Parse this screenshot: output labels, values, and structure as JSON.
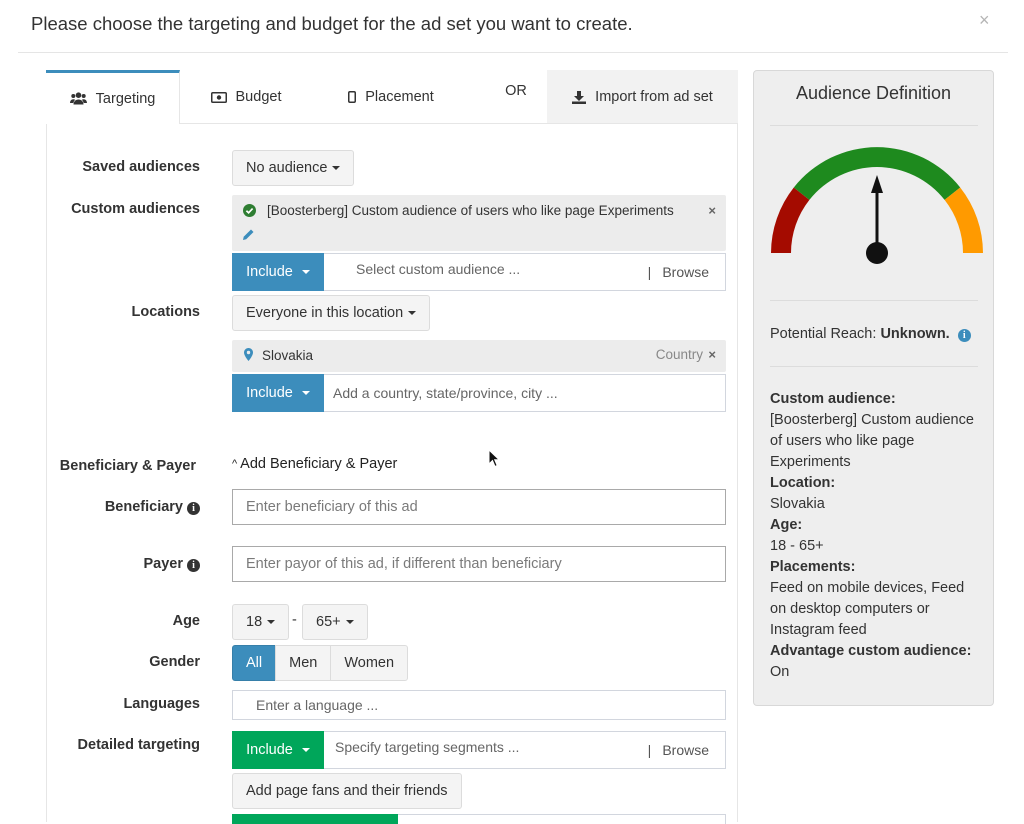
{
  "modal": {
    "title": "Please choose the targeting and budget for the ad set you want to create.",
    "close": "×"
  },
  "tabs": {
    "targeting": "Targeting",
    "budget": "Budget",
    "placement": "Placement",
    "or": "OR",
    "import": "Import from ad set"
  },
  "form": {
    "saved_audiences": {
      "label": "Saved audiences",
      "value": "No audience"
    },
    "custom_audiences": {
      "label": "Custom audiences",
      "chip_text": "[Boosterberg] Custom audience of users who like page Experiments",
      "include_label": "Include",
      "placeholder": "Select custom audience ...",
      "browse": "Browse"
    },
    "locations": {
      "label": "Locations",
      "mode": "Everyone in this location",
      "chip_text": "Slovakia",
      "chip_type": "Country",
      "include_label": "Include",
      "placeholder": "Add a country, state/province, city ..."
    },
    "beneficiary_payer": {
      "label": "Beneficiary & Payer",
      "toggle": "Add Beneficiary & Payer"
    },
    "beneficiary": {
      "label": "Beneficiary",
      "placeholder": "Enter beneficiary of this ad"
    },
    "payer": {
      "label": "Payer",
      "placeholder": "Enter payor of this ad, if different than beneficiary"
    },
    "age": {
      "label": "Age",
      "min": "18",
      "separator": "-",
      "max": "65+"
    },
    "gender": {
      "label": "Gender",
      "options": [
        "All",
        "Men",
        "Women"
      ],
      "selected": "All"
    },
    "languages": {
      "label": "Languages",
      "placeholder": "Enter a language ..."
    },
    "detailed_targeting": {
      "label": "Detailed targeting",
      "include_label": "Include",
      "placeholder": "Specify targeting segments ...",
      "browse": "Browse",
      "add_button": "Add page fans and their friends"
    }
  },
  "audience_panel": {
    "title": "Audience Definition",
    "gauge": {
      "needle_direction": "up",
      "zones": [
        "red",
        "green",
        "orange"
      ]
    },
    "reach_label": "Potential Reach:",
    "reach_value": "Unknown.",
    "summary": [
      {
        "heading": "Custom audience:",
        "value": "[Boosterberg] Custom audience of users who like page Experiments"
      },
      {
        "heading": "Location:",
        "value": "Slovakia"
      },
      {
        "heading": "Age:",
        "value": "18 - 65+"
      },
      {
        "heading": "Placements:",
        "value": "Feed on mobile devices, Feed on desktop computers or Instagram feed"
      },
      {
        "heading": "Advantage custom audience:",
        "value": "On"
      }
    ]
  },
  "colors": {
    "primary": "#3c8dbc",
    "success": "#00a65a",
    "gauge_red": "#a40b00",
    "gauge_green": "#1e8a1e",
    "gauge_orange": "#ff9a00"
  }
}
